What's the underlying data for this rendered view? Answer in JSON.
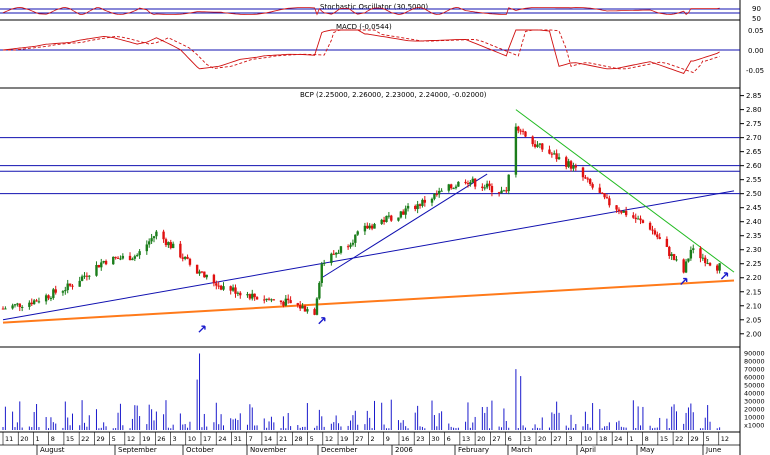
{
  "stoch_panel": {
    "title": "Stochastic Oscillator (30,5000)",
    "ticks": [
      "90",
      "50",
      "10"
    ]
  },
  "macd_panel": {
    "title": "MACD (-0.0544)",
    "ticks": [
      "0.05",
      "0.00",
      "-0.05"
    ]
  },
  "price_panel": {
    "title": "BCP (2.25000, 2.26000, 2.23000, 2.24000, -0.02000)",
    "ticks": [
      "2.85",
      "2.80",
      "2.75",
      "2.70",
      "2.65",
      "2.60",
      "2.55",
      "2.50",
      "2.45",
      "2.40",
      "2.35",
      "2.30",
      "2.25",
      "2.20",
      "2.15",
      "2.10",
      "2.05",
      "2.00"
    ]
  },
  "volume_panel": {
    "ticks": [
      "90000",
      "80000",
      "70000",
      "60000",
      "50000",
      "40000",
      "30000",
      "20000",
      "10000",
      "x1000"
    ]
  },
  "x_axis": {
    "day_ticks": [
      "11",
      "20",
      "1",
      "8",
      "15",
      "22",
      "29",
      "5",
      "12",
      "19",
      "26",
      "3",
      "10",
      "17",
      "24",
      "31",
      "7",
      "14",
      "21",
      "28",
      "5",
      "12",
      "19",
      "27",
      "2",
      "9",
      "16",
      "23",
      "30",
      "6",
      "13",
      "20",
      "27",
      "6",
      "13",
      "20",
      "27",
      "3",
      "10",
      "18",
      "24",
      "1",
      "8",
      "15",
      "22",
      "29",
      "5",
      "12"
    ],
    "months": [
      "August",
      "September",
      "October",
      "November",
      "December",
      "2006",
      "February",
      "March",
      "April",
      "May",
      "June"
    ]
  },
  "colors": {
    "up": "#1b7d1b",
    "down": "#e01010",
    "hline": "#1010b0",
    "trend": "#1010b0",
    "support": "#ff7a1a",
    "resistance": "#22bb22",
    "volume": "#1a1acc",
    "oscillator": "#d01010"
  },
  "chart_data": {
    "type": "candlestick",
    "title": "BCP (2.25000, 2.26000, 2.23000, 2.24000, -0.02000)",
    "x_range": [
      "2005-08-11",
      "2006-06-12"
    ],
    "ylim": [
      1.96,
      2.87
    ],
    "horizontal_levels": [
      2.7,
      2.6,
      2.58,
      2.5
    ],
    "price_path": {
      "dates": [
        "2005-08-11",
        "2005-08-25",
        "2005-09-08",
        "2005-09-22",
        "2005-10-06",
        "2005-10-14",
        "2005-10-22",
        "2005-10-31",
        "2005-11-10",
        "2005-11-25",
        "2005-12-08",
        "2005-12-19",
        "2005-12-22",
        "2006-01-10",
        "2006-01-31",
        "2006-02-20",
        "2006-03-09",
        "2006-03-13",
        "2006-03-20",
        "2006-04-05",
        "2006-04-20",
        "2006-05-08",
        "2006-05-22",
        "2006-05-25",
        "2006-06-05"
      ],
      "close": [
        2.09,
        2.12,
        2.17,
        2.26,
        2.28,
        2.36,
        2.3,
        2.22,
        2.17,
        2.13,
        2.11,
        2.08,
        2.25,
        2.38,
        2.46,
        2.55,
        2.5,
        2.75,
        2.68,
        2.6,
        2.47,
        2.38,
        2.22,
        2.3,
        2.24
      ]
    },
    "volume_bars": {
      "spikes": [
        {
          "date": "2005-11-01",
          "value": 88000
        },
        {
          "date": "2006-03-13",
          "value": 70000
        },
        {
          "date": "2005-10-31",
          "value": 58000
        },
        {
          "date": "2006-03-15",
          "value": 62000
        }
      ],
      "typical_range": [
        2000,
        35000
      ]
    },
    "trendlines": [
      {
        "name": "rising-channel-lower",
        "from": {
          "date": "2005-08-11",
          "price": 2.04
        },
        "to": {
          "date": "2006-06-12",
          "price": 2.19
        },
        "color": "orange"
      },
      {
        "name": "rising-channel-upper",
        "from": {
          "date": "2005-08-11",
          "price": 2.05
        },
        "to": {
          "date": "2006-06-12",
          "price": 2.51
        },
        "color": "blue"
      },
      {
        "name": "dec-feb-support",
        "from": {
          "date": "2005-12-22",
          "price": 2.2
        },
        "to": {
          "date": "2006-03-01",
          "price": 2.57
        },
        "color": "blue"
      },
      {
        "name": "march-may-resistance",
        "from": {
          "date": "2006-03-13",
          "price": 2.8
        },
        "to": {
          "date": "2006-06-12",
          "price": 2.22
        },
        "color": "green"
      }
    ],
    "oscillators": {
      "stochastic": {
        "overbought": 90,
        "oversold": 10
      },
      "macd": {
        "range": [
          -0.07,
          0.06
        ]
      }
    }
  }
}
